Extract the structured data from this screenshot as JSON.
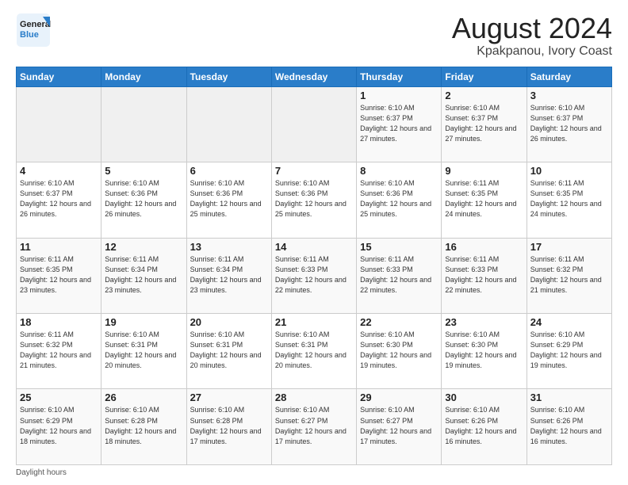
{
  "header": {
    "logo_line1": "General",
    "logo_line2": "Blue",
    "title": "August 2024",
    "subtitle": "Kpakpanou, Ivory Coast"
  },
  "days_of_week": [
    "Sunday",
    "Monday",
    "Tuesday",
    "Wednesday",
    "Thursday",
    "Friday",
    "Saturday"
  ],
  "weeks": [
    [
      {
        "day": "",
        "info": ""
      },
      {
        "day": "",
        "info": ""
      },
      {
        "day": "",
        "info": ""
      },
      {
        "day": "",
        "info": ""
      },
      {
        "day": "1",
        "info": "Sunrise: 6:10 AM\nSunset: 6:37 PM\nDaylight: 12 hours\nand 27 minutes."
      },
      {
        "day": "2",
        "info": "Sunrise: 6:10 AM\nSunset: 6:37 PM\nDaylight: 12 hours\nand 27 minutes."
      },
      {
        "day": "3",
        "info": "Sunrise: 6:10 AM\nSunset: 6:37 PM\nDaylight: 12 hours\nand 26 minutes."
      }
    ],
    [
      {
        "day": "4",
        "info": "Sunrise: 6:10 AM\nSunset: 6:37 PM\nDaylight: 12 hours\nand 26 minutes."
      },
      {
        "day": "5",
        "info": "Sunrise: 6:10 AM\nSunset: 6:36 PM\nDaylight: 12 hours\nand 26 minutes."
      },
      {
        "day": "6",
        "info": "Sunrise: 6:10 AM\nSunset: 6:36 PM\nDaylight: 12 hours\nand 25 minutes."
      },
      {
        "day": "7",
        "info": "Sunrise: 6:10 AM\nSunset: 6:36 PM\nDaylight: 12 hours\nand 25 minutes."
      },
      {
        "day": "8",
        "info": "Sunrise: 6:10 AM\nSunset: 6:36 PM\nDaylight: 12 hours\nand 25 minutes."
      },
      {
        "day": "9",
        "info": "Sunrise: 6:11 AM\nSunset: 6:35 PM\nDaylight: 12 hours\nand 24 minutes."
      },
      {
        "day": "10",
        "info": "Sunrise: 6:11 AM\nSunset: 6:35 PM\nDaylight: 12 hours\nand 24 minutes."
      }
    ],
    [
      {
        "day": "11",
        "info": "Sunrise: 6:11 AM\nSunset: 6:35 PM\nDaylight: 12 hours\nand 23 minutes."
      },
      {
        "day": "12",
        "info": "Sunrise: 6:11 AM\nSunset: 6:34 PM\nDaylight: 12 hours\nand 23 minutes."
      },
      {
        "day": "13",
        "info": "Sunrise: 6:11 AM\nSunset: 6:34 PM\nDaylight: 12 hours\nand 23 minutes."
      },
      {
        "day": "14",
        "info": "Sunrise: 6:11 AM\nSunset: 6:33 PM\nDaylight: 12 hours\nand 22 minutes."
      },
      {
        "day": "15",
        "info": "Sunrise: 6:11 AM\nSunset: 6:33 PM\nDaylight: 12 hours\nand 22 minutes."
      },
      {
        "day": "16",
        "info": "Sunrise: 6:11 AM\nSunset: 6:33 PM\nDaylight: 12 hours\nand 22 minutes."
      },
      {
        "day": "17",
        "info": "Sunrise: 6:11 AM\nSunset: 6:32 PM\nDaylight: 12 hours\nand 21 minutes."
      }
    ],
    [
      {
        "day": "18",
        "info": "Sunrise: 6:11 AM\nSunset: 6:32 PM\nDaylight: 12 hours\nand 21 minutes."
      },
      {
        "day": "19",
        "info": "Sunrise: 6:10 AM\nSunset: 6:31 PM\nDaylight: 12 hours\nand 20 minutes."
      },
      {
        "day": "20",
        "info": "Sunrise: 6:10 AM\nSunset: 6:31 PM\nDaylight: 12 hours\nand 20 minutes."
      },
      {
        "day": "21",
        "info": "Sunrise: 6:10 AM\nSunset: 6:31 PM\nDaylight: 12 hours\nand 20 minutes."
      },
      {
        "day": "22",
        "info": "Sunrise: 6:10 AM\nSunset: 6:30 PM\nDaylight: 12 hours\nand 19 minutes."
      },
      {
        "day": "23",
        "info": "Sunrise: 6:10 AM\nSunset: 6:30 PM\nDaylight: 12 hours\nand 19 minutes."
      },
      {
        "day": "24",
        "info": "Sunrise: 6:10 AM\nSunset: 6:29 PM\nDaylight: 12 hours\nand 19 minutes."
      }
    ],
    [
      {
        "day": "25",
        "info": "Sunrise: 6:10 AM\nSunset: 6:29 PM\nDaylight: 12 hours\nand 18 minutes."
      },
      {
        "day": "26",
        "info": "Sunrise: 6:10 AM\nSunset: 6:28 PM\nDaylight: 12 hours\nand 18 minutes."
      },
      {
        "day": "27",
        "info": "Sunrise: 6:10 AM\nSunset: 6:28 PM\nDaylight: 12 hours\nand 17 minutes."
      },
      {
        "day": "28",
        "info": "Sunrise: 6:10 AM\nSunset: 6:27 PM\nDaylight: 12 hours\nand 17 minutes."
      },
      {
        "day": "29",
        "info": "Sunrise: 6:10 AM\nSunset: 6:27 PM\nDaylight: 12 hours\nand 17 minutes."
      },
      {
        "day": "30",
        "info": "Sunrise: 6:10 AM\nSunset: 6:26 PM\nDaylight: 12 hours\nand 16 minutes."
      },
      {
        "day": "31",
        "info": "Sunrise: 6:10 AM\nSunset: 6:26 PM\nDaylight: 12 hours\nand 16 minutes."
      }
    ]
  ],
  "footer": "Daylight hours"
}
